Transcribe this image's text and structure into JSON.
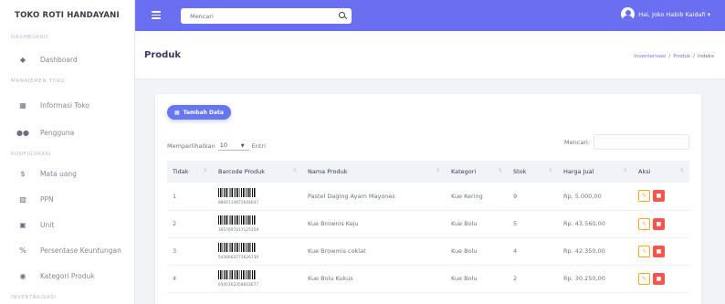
{
  "sidebar": {
    "brand": "TOKO ROTI HANDAYANI",
    "sections": [
      {
        "heading": "DASHBOARD",
        "items": [
          {
            "label": "Dashboard",
            "icon": "fire-icon"
          }
        ]
      },
      {
        "heading": "MANAJEMEN TOKO",
        "items": [
          {
            "label": "Informasi Toko",
            "icon": "store-icon"
          },
          {
            "label": "Pengguna",
            "icon": "users-icon"
          }
        ]
      },
      {
        "heading": "KONFIGURASI",
        "items": [
          {
            "label": "Mata uang",
            "icon": "dollar-icon"
          },
          {
            "label": "PPN",
            "icon": "money-icon"
          },
          {
            "label": "Unit",
            "icon": "box-icon"
          },
          {
            "label": "Persentase Keuntungan",
            "icon": "percent-icon"
          },
          {
            "label": "Kategori Produk",
            "icon": "tag-icon"
          }
        ]
      },
      {
        "heading": "INVENTARISASI",
        "items": []
      }
    ]
  },
  "topbar": {
    "search_placeholder": "Mencari",
    "user_name": "Hai, Joko Habib Kaidafi ▾",
    "bg_color": "#6a6ff1"
  },
  "page": {
    "title": "Produk",
    "breadcrumb": [
      "Inventarisasi",
      "Produk",
      "Indeks"
    ]
  },
  "card": {
    "add_button": "Tambah Data",
    "length_prefix": "Memperlihatkan",
    "length_value": "10",
    "length_suffix": "Entri",
    "search_label": "Mencari:",
    "columns": [
      "Tidak",
      "Barcode Produk",
      "Nama Produk",
      "Kategori",
      "Stok",
      "Harga Jual",
      "Aksi"
    ],
    "rows": [
      {
        "no": "1",
        "barcode": "8800114672644647",
        "name": "Pastel Daging Ayam Mayones",
        "category": "Kue Kering",
        "stock": "9",
        "price": "Rp. 5.000,00"
      },
      {
        "no": "2",
        "barcode": "3657697017125359",
        "name": "Kue Brownis Keju",
        "category": "Kue Bolu",
        "stock": "5",
        "price": "Rp. 43.560,00"
      },
      {
        "no": "3",
        "barcode": "5436663773626730",
        "name": "Kue Browmis coklat",
        "category": "Kue Bolu",
        "stock": "4",
        "price": "Rp. 42.350,00"
      },
      {
        "no": "4",
        "barcode": "6500162358603677",
        "name": "Kue Bolu Kukus",
        "category": "Kue Bolu",
        "stock": "2",
        "price": "Rp. 30.250,00"
      }
    ]
  },
  "colors": {
    "primary": "#6777ef",
    "warning": "#ffa426",
    "danger": "#fc544b"
  }
}
